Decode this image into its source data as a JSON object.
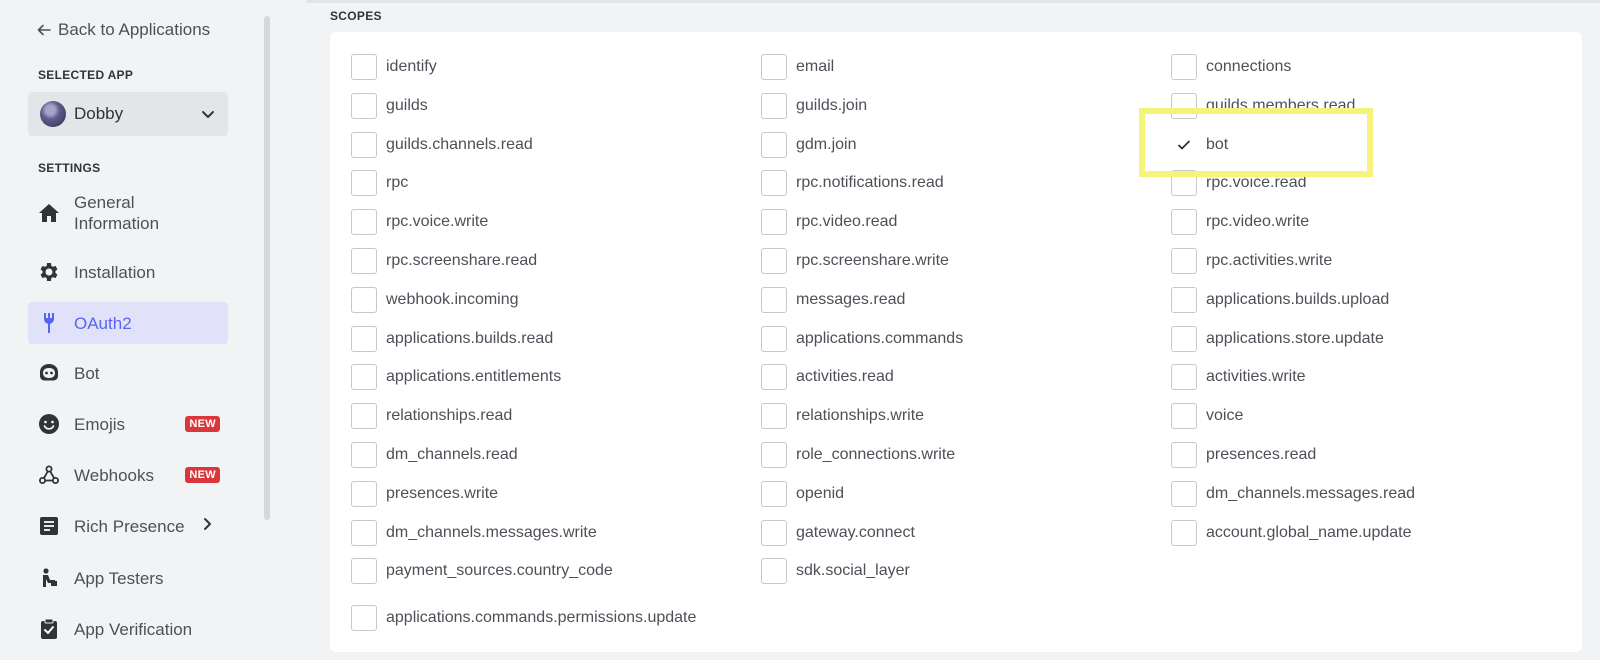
{
  "sidebar": {
    "back_label": "Back to Applications",
    "selected_app_label": "SELECTED APP",
    "app_name": "Dobby",
    "settings_label": "SETTINGS",
    "items": [
      {
        "label": "General Information",
        "icon": "home-icon"
      },
      {
        "label": "Installation",
        "icon": "gear-icon"
      },
      {
        "label": "OAuth2",
        "icon": "wrench-icon",
        "active": true
      },
      {
        "label": "Bot",
        "icon": "bot-icon"
      },
      {
        "label": "Emojis",
        "icon": "emoji-icon",
        "badge": "NEW"
      },
      {
        "label": "Webhooks",
        "icon": "webhook-icon",
        "badge": "NEW"
      },
      {
        "label": "Rich Presence",
        "icon": "document-icon"
      },
      {
        "label": "App Testers",
        "icon": "person-icon"
      },
      {
        "label": "App Verification",
        "icon": "clipboard-check-icon"
      }
    ]
  },
  "scopes": {
    "title": "SCOPES",
    "columns": [
      [
        "identify",
        "guilds",
        "guilds.channels.read",
        "rpc",
        "rpc.voice.write",
        "rpc.screenshare.read",
        "webhook.incoming",
        "applications.builds.read",
        "applications.entitlements",
        "relationships.read",
        "dm_channels.read",
        "presences.write",
        "dm_channels.messages.write",
        "payment_sources.country_code"
      ],
      [
        "email",
        "guilds.join",
        "gdm.join",
        "rpc.notifications.read",
        "rpc.video.read",
        "rpc.screenshare.write",
        "messages.read",
        "applications.commands",
        "activities.read",
        "relationships.write",
        "role_connections.write",
        "openid",
        "gateway.connect",
        "sdk.social_layer"
      ],
      [
        "connections",
        "guilds.members.read",
        "bot",
        "rpc.voice.read",
        "rpc.video.write",
        "rpc.activities.write",
        "applications.builds.upload",
        "applications.store.update",
        "activities.write",
        "voice",
        "presences.read",
        "dm_channels.messages.read",
        "account.global_name.update"
      ]
    ],
    "last": "applications.commands.permissions.update",
    "checked": [
      "bot"
    ]
  },
  "colors": {
    "accent": "#5865f2",
    "active_bg": "#e1e2f9",
    "badge": "#da373c",
    "highlight": "#f4f47a"
  }
}
